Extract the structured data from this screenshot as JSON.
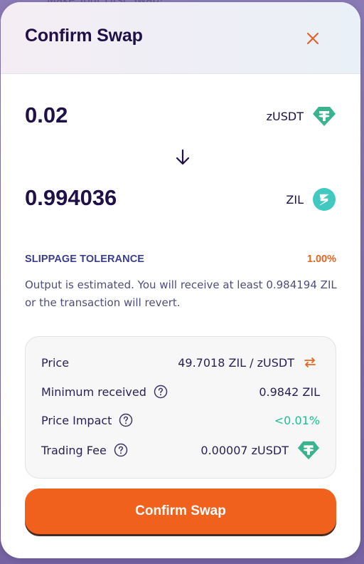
{
  "background": {
    "peek_text": "Make Your First Swap!"
  },
  "modal": {
    "title": "Confirm Swap",
    "close_icon": "close-icon"
  },
  "swap": {
    "input": {
      "amount": "0.02",
      "token": "zUSDT",
      "icon": "tether-icon"
    },
    "direction_icon": "arrow-down-icon",
    "output": {
      "amount": "0.994036",
      "token": "ZIL",
      "icon": "zilliqa-icon"
    }
  },
  "slippage": {
    "label": "SLIPPAGE TOLERANCE",
    "value": "1.00%",
    "note": "Output is estimated. You will receive at least 0.984194 ZIL or the transaction will revert."
  },
  "details": {
    "price": {
      "label": "Price",
      "value": "49.7018 ZIL / zUSDT",
      "icon": "swap-arrows-icon"
    },
    "minimum_received": {
      "label": "Minimum received",
      "value": "0.9842 ZIL"
    },
    "price_impact": {
      "label": "Price Impact",
      "value": "<0.01%"
    },
    "trading_fee": {
      "label": "Trading Fee",
      "value": "0.00007 zUSDT",
      "icon": "tether-icon"
    }
  },
  "confirm_button": {
    "label": "Confirm Swap"
  },
  "colors": {
    "accent": "#f0611d",
    "title": "#1f1147",
    "slippage_label": "#3b3d8f",
    "positive": "#1fbf8f",
    "tether": "#3ab38e",
    "zilliqa": "#41c9c1"
  }
}
